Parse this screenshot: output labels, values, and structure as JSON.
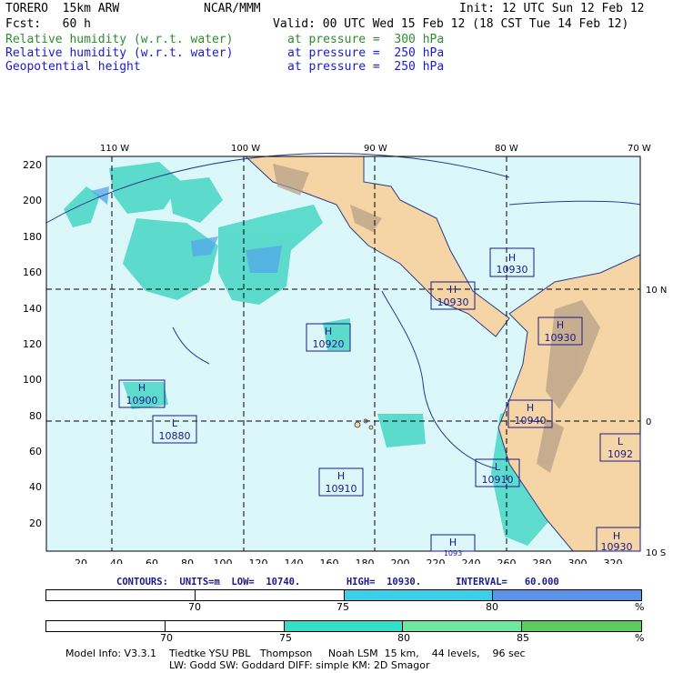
{
  "header": {
    "model": "TORERO  15km ARW",
    "org": "NCAR/MMM",
    "init": "Init: 12 UTC Sun 12 Feb 12",
    "fcst": "Fcst:   60 h",
    "valid": "Valid: 00 UTC Wed 15 Feb 12 (18 CST Tue 14 Feb 12)",
    "fields": [
      {
        "name": "Relative humidity (w.r.t. water)",
        "level": "at pressure =  300 hPa",
        "color": "#2e8b2e"
      },
      {
        "name": "Relative humidity (w.r.t. water)",
        "level": "at pressure =  250 hPa",
        "color": "#1a1ad0"
      },
      {
        "name": "Geopotential height",
        "level": "at pressure =  250 hPa",
        "color": "#1a1ad0"
      }
    ]
  },
  "map": {
    "top_lon_labels": [
      "110 W",
      "100 W",
      "90 W",
      "80 W",
      "70 W"
    ],
    "right_lat_labels": [
      "10 N",
      "0",
      "10 S"
    ],
    "left_y_ticks": [
      "220",
      "200",
      "180",
      "160",
      "140",
      "120",
      "100",
      "80",
      "60",
      "40",
      "20"
    ],
    "bottom_x_ticks": [
      "20",
      "40",
      "60",
      "80",
      "100",
      "120",
      "140",
      "160",
      "180",
      "200",
      "220",
      "240",
      "260",
      "280",
      "300",
      "320"
    ],
    "ocean_color": "#dcf7fa",
    "land_color": "#f5d5a6",
    "highs_lows": [
      {
        "type": "H",
        "value": "10930"
      },
      {
        "type": "H",
        "value": "10930"
      },
      {
        "type": "H",
        "value": "10930"
      },
      {
        "type": "H",
        "value": "10920"
      },
      {
        "type": "H",
        "value": "10900"
      },
      {
        "type": "L",
        "value": "10880"
      },
      {
        "type": "H",
        "value": "10940"
      },
      {
        "type": "H",
        "value": "10910"
      },
      {
        "type": "L",
        "value": "10910"
      },
      {
        "type": "L",
        "value": "1092"
      },
      {
        "type": "H",
        "value": "10930"
      },
      {
        "type": "H",
        "value": "1093"
      }
    ]
  },
  "contours": "CONTOURS:  UNITS=m  LOW=  10740.        HIGH=  10930.      INTERVAL=   60.000",
  "colorbar1": {
    "labels": [
      "70",
      "75",
      "80",
      "%"
    ],
    "colors": [
      "#ffffff",
      "#ffffff",
      "#3ad0e8",
      "#5b93e8"
    ]
  },
  "colorbar2": {
    "labels": [
      "70",
      "75",
      "80",
      "85",
      "%"
    ],
    "colors": [
      "#ffffff",
      "#ffffff",
      "#30e0c8",
      "#6ee7a0",
      "#5ccd5c"
    ]
  },
  "footer": {
    "line1": "Model Info: V3.3.1    Tiedtke YSU PBL   Thompson     Noah LSM  15 km,    44 levels,    96 sec",
    "line2": "LW: Godd SW: Goddard DIFF: simple KM: 2D Smagor"
  }
}
